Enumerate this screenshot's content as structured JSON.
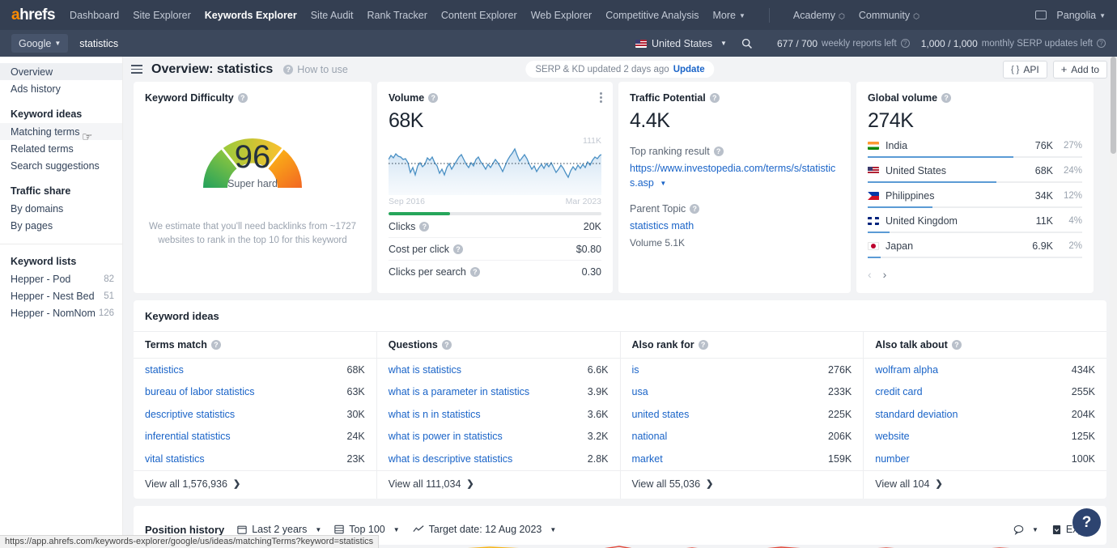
{
  "topnav": {
    "logo": "ahrefs",
    "links": [
      {
        "label": "Dashboard",
        "active": false
      },
      {
        "label": "Site Explorer",
        "active": false
      },
      {
        "label": "Keywords Explorer",
        "active": true
      },
      {
        "label": "Site Audit",
        "active": false
      },
      {
        "label": "Rank Tracker",
        "active": false
      },
      {
        "label": "Content Explorer",
        "active": false
      },
      {
        "label": "Web Explorer",
        "active": false
      },
      {
        "label": "Competitive Analysis",
        "active": false
      },
      {
        "label": "More",
        "active": false
      }
    ],
    "academy": "Academy",
    "community": "Community",
    "account": "Pangolia"
  },
  "searchbar": {
    "engine": "Google",
    "keyword_value": "statistics",
    "keyword_placeholder": "Enter keyword",
    "country": "United States",
    "weekly_reports": "677 / 700",
    "weekly_reports_label": "weekly reports left",
    "serp_updates": "1,000 / 1,000",
    "serp_updates_label": "monthly SERP updates left"
  },
  "sidebar": {
    "top_items": [
      {
        "label": "Overview",
        "selected": true
      },
      {
        "label": "Ads history",
        "selected": false
      }
    ],
    "keyword_ideas_heading": "Keyword ideas",
    "keyword_ideas": [
      {
        "label": "Matching terms",
        "hover": true
      },
      {
        "label": "Related terms",
        "hover": false
      },
      {
        "label": "Search suggestions",
        "hover": false
      }
    ],
    "traffic_share_heading": "Traffic share",
    "traffic_share": [
      {
        "label": "By domains"
      },
      {
        "label": "By pages"
      }
    ],
    "keyword_lists_heading": "Keyword lists",
    "keyword_lists": [
      {
        "label": "Hepper - Pod",
        "count": "82"
      },
      {
        "label": "Hepper - Nest Bed",
        "count": "51"
      },
      {
        "label": "Hepper - NomNom",
        "count": "126"
      }
    ]
  },
  "mainheader": {
    "title": "Overview: statistics",
    "how_to_use": "How to use",
    "serp_chip_text": "SERP & KD updated 2 days ago",
    "serp_chip_action": "Update",
    "api_button": "API",
    "add_to_button": "Add to"
  },
  "keyword_difficulty": {
    "title": "Keyword Difficulty",
    "score": "96",
    "label": "Super hard",
    "note": "We estimate that you'll need backlinks from ~1727 websites to rank in the top 10 for this keyword"
  },
  "volume": {
    "title": "Volume",
    "value": "68K",
    "max_label": "111K",
    "date_start": "Sep 2016",
    "date_end": "Mar 2023",
    "bar_percent": 29,
    "rows": [
      {
        "label": "Clicks",
        "value": "20K"
      },
      {
        "label": "Cost per click",
        "value": "$0.80"
      },
      {
        "label": "Clicks per search",
        "value": "0.30"
      }
    ]
  },
  "traffic_potential": {
    "title": "Traffic Potential",
    "value": "4.4K",
    "top_ranking_label": "Top ranking result",
    "top_ranking_url": "https://www.investopedia.com/terms/s/statistics.asp",
    "parent_topic_label": "Parent Topic",
    "parent_topic": "statistics math",
    "parent_volume": "Volume 5.1K"
  },
  "global_volume": {
    "title": "Global volume",
    "value": "274K",
    "countries": [
      {
        "name": "India",
        "volume": "76K",
        "pct": "27%",
        "bar": 68,
        "flag": "flag-india"
      },
      {
        "name": "United States",
        "volume": "68K",
        "pct": "24%",
        "bar": 60,
        "flag": "flag-us"
      },
      {
        "name": "Philippines",
        "volume": "34K",
        "pct": "12%",
        "bar": 30,
        "flag": "flag-philippines"
      },
      {
        "name": "United Kingdom",
        "volume": "11K",
        "pct": "4%",
        "bar": 10,
        "flag": "flag-uk"
      },
      {
        "name": "Japan",
        "volume": "6.9K",
        "pct": "2%",
        "bar": 6,
        "flag": "flag-japan"
      }
    ]
  },
  "keyword_ideas": {
    "title": "Keyword ideas",
    "columns": [
      {
        "header": "Terms match",
        "rows": [
          {
            "term": "statistics",
            "value": "68K"
          },
          {
            "term": "bureau of labor statistics",
            "value": "63K"
          },
          {
            "term": "descriptive statistics",
            "value": "30K"
          },
          {
            "term": "inferential statistics",
            "value": "24K"
          },
          {
            "term": "vital statistics",
            "value": "23K"
          }
        ],
        "view_all": "View all 1,576,936"
      },
      {
        "header": "Questions",
        "rows": [
          {
            "term": "what is statistics",
            "value": "6.6K"
          },
          {
            "term": "what is a parameter in statistics",
            "value": "3.9K"
          },
          {
            "term": "what is n in statistics",
            "value": "3.6K"
          },
          {
            "term": "what is power in statistics",
            "value": "3.2K"
          },
          {
            "term": "what is descriptive statistics",
            "value": "2.8K"
          }
        ],
        "view_all": "View all 111,034"
      },
      {
        "header": "Also rank for",
        "rows": [
          {
            "term": "is",
            "value": "276K"
          },
          {
            "term": "usa",
            "value": "233K"
          },
          {
            "term": "united states",
            "value": "225K"
          },
          {
            "term": "national",
            "value": "206K"
          },
          {
            "term": "market",
            "value": "159K"
          }
        ],
        "view_all": "View all 55,036"
      },
      {
        "header": "Also talk about",
        "rows": [
          {
            "term": "wolfram alpha",
            "value": "434K"
          },
          {
            "term": "credit card",
            "value": "255K"
          },
          {
            "term": "standard deviation",
            "value": "204K"
          },
          {
            "term": "website",
            "value": "125K"
          },
          {
            "term": "number",
            "value": "100K"
          }
        ],
        "view_all": "View all 104"
      }
    ]
  },
  "position_history": {
    "title": "Position history",
    "range": "Last 2 years",
    "top": "Top 100",
    "target_date": "Target date: 12 Aug 2023",
    "export": "Export"
  },
  "statusbar": {
    "url": "https://app.ahrefs.com/keywords-explorer/google/us/ideas/matchingTerms?keyword=statistics"
  },
  "help": {
    "label": "?"
  },
  "colors": {
    "nav_bg": "#343f52",
    "search_bg": "#3c485c",
    "accent_orange": "#ff8b00",
    "link_blue": "#1a64c8",
    "green": "#26a65b",
    "page_bg": "#f2f3f5"
  }
}
